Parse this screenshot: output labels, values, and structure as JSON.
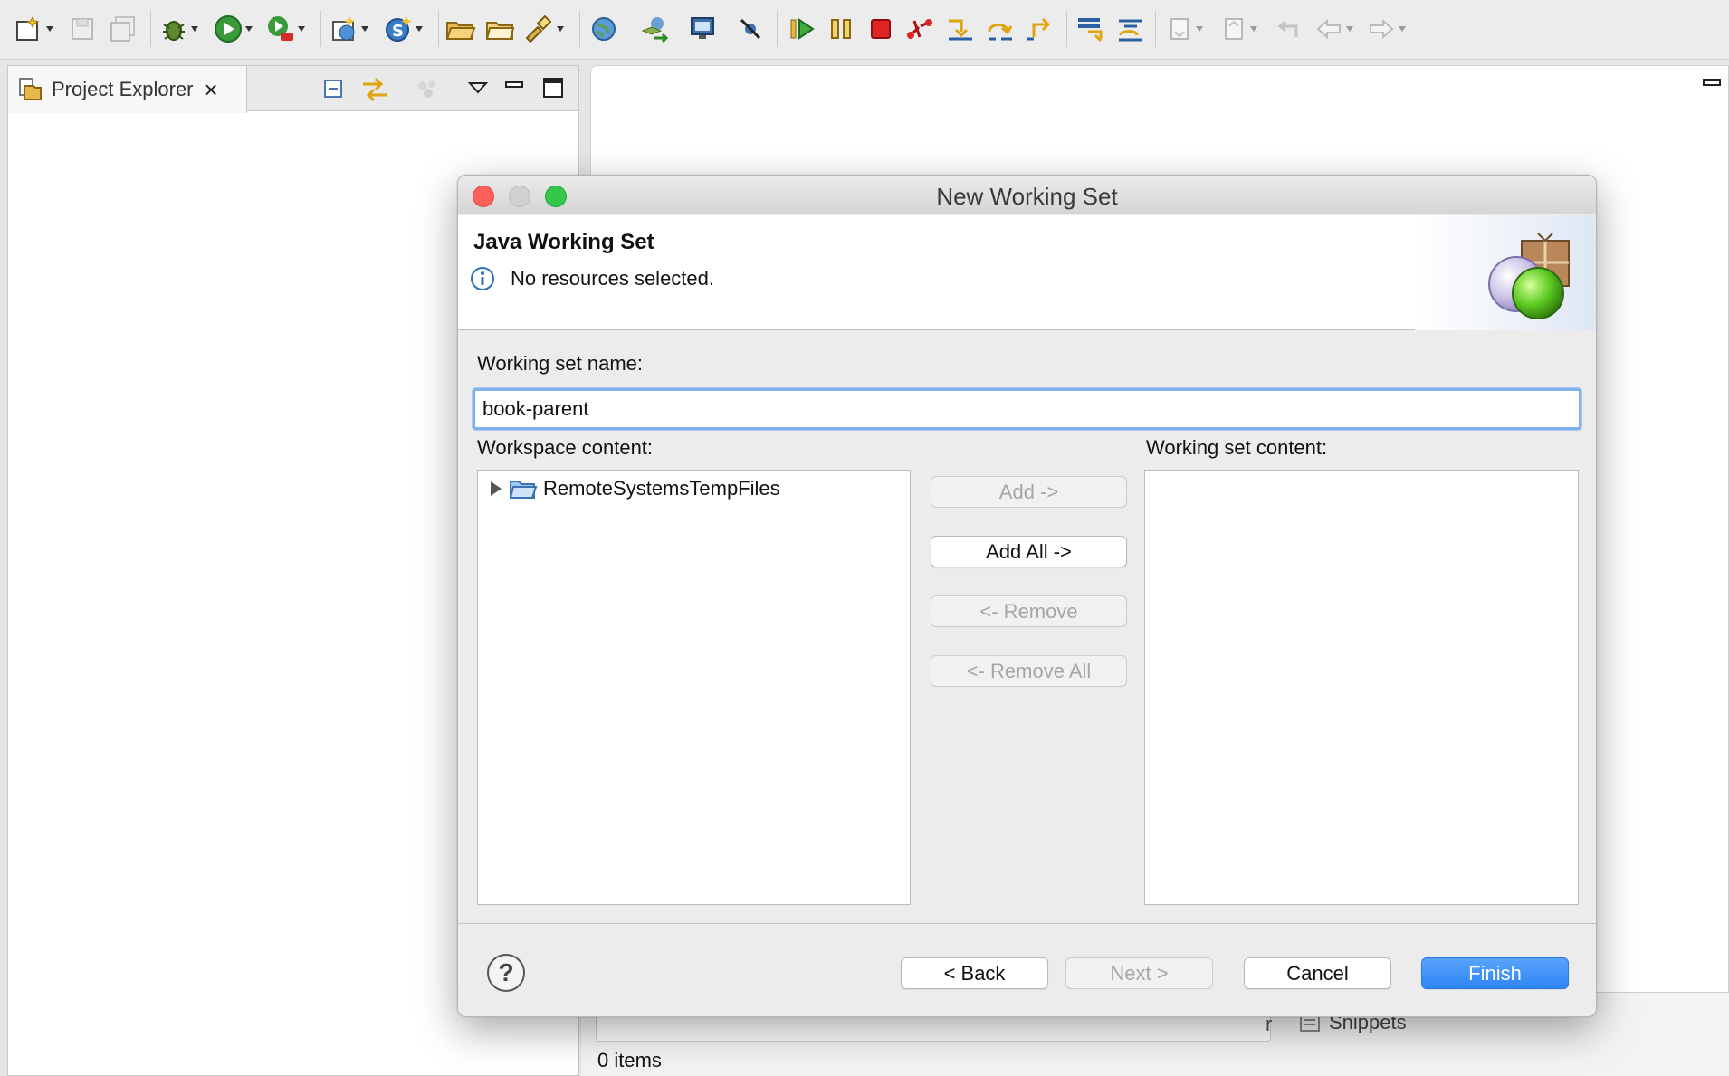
{
  "explorer": {
    "tab_label": "Project Explorer",
    "close_glyph": "×"
  },
  "bottom": {
    "items_count": "0 items",
    "tab_partial": "r",
    "snippets_label": "Snippets"
  },
  "dialog": {
    "title": "New Working Set",
    "banner_title": "Java Working Set",
    "banner_message": "No resources selected.",
    "name_label": "Working set name:",
    "name_value": "book-parent",
    "workspace_label": "Workspace content:",
    "set_content_label": "Working set content:",
    "workspace_items": [
      {
        "name": "RemoteSystemsTempFiles",
        "icon": "folder-open-icon"
      }
    ],
    "buttons": {
      "add": "Add ->",
      "add_all": "Add All ->",
      "remove": "<- Remove",
      "remove_all": "<- Remove All",
      "back": "< Back",
      "next": "Next >",
      "cancel": "Cancel",
      "finish": "Finish"
    },
    "help_glyph": "?"
  },
  "colors": {
    "accent": "#2e86f6",
    "focus_ring": "#7fb1ea",
    "close_light": "#fc605c",
    "minimize_light": "#d0d0d0",
    "maximize_light": "#34c84a"
  }
}
